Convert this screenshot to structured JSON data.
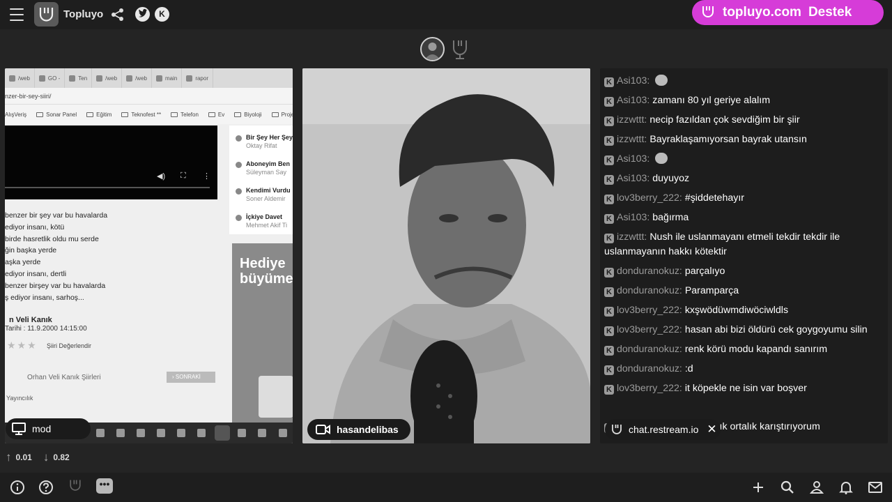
{
  "topbar": {
    "app_title": "Topluyo",
    "icons": [
      "menu-icon",
      "logo-icon",
      "share-icon",
      "twitter-icon",
      "kick-icon"
    ],
    "kick_glyph": "K"
  },
  "promo": {
    "text": "topluyo.com",
    "text2": "Destek"
  },
  "screen_share": {
    "tabs": [
      "/web",
      "GO -",
      "Ten",
      "/web",
      "/web",
      "main",
      "rapor"
    ],
    "url": "nzer-bir-sey-siiri/",
    "bookmarks": [
      "AlışVeriş",
      "Sonar Panel",
      "Eğitim",
      "Teknofest **",
      "Telefon",
      "Ev",
      "Biyoloji",
      "Proje"
    ],
    "video_controls": [
      "◀)",
      "⛶",
      "⋮"
    ],
    "poem_lines": [
      "benzer bir şey var bu havalarda",
      "ediyor insanı, kötü",
      "birde hasretlik oldu mu serde",
      "ğin başka yerde",
      "aşka yerde",
      "ediyor insanı, dertli",
      "benzer birşey var bu havalarda",
      "ş ediyor insanı, sarhoş..."
    ],
    "poet_name": "n Veli Kanık",
    "date": "Tarihi : 11.9.2000 14:15:00",
    "stars": "★★★",
    "rate_label": "Şiiri Değerlendir",
    "poet_poems": "Orhan Veli Kanık Şiirleri",
    "next_button": "› SONRAKİ",
    "publisher": "Yayıncılık",
    "side_items": [
      {
        "title": "Bir Şey Her Şey",
        "author": "Oktay Rifat"
      },
      {
        "title": "Aboneyim Ben",
        "author": "Süleyman Say"
      },
      {
        "title": "Kendimi Vurdu",
        "author": "Soner Aldemir"
      },
      {
        "title": "İçkiye Davet",
        "author": "Mehmet Akif Ti"
      }
    ],
    "ad_text": [
      "Hediye",
      "büyüme"
    ],
    "badge_label": "mod"
  },
  "webcam": {
    "badge_label": "hasandelibas"
  },
  "chat": {
    "messages": [
      {
        "user": "Asi103:",
        "text": "",
        "emoji": true
      },
      {
        "user": "Asi103:",
        "text": "zamanı 80 yıl geriye alalım",
        "emoji": false
      },
      {
        "user": "izzwttt:",
        "text": "necip fazıldan çok sevdiğim bir şiir",
        "emoji": false
      },
      {
        "user": "izzwttt:",
        "text": "Bayraklaşamıyorsan bayrak utansın",
        "emoji": false
      },
      {
        "user": "Asi103:",
        "text": "",
        "emoji": true
      },
      {
        "user": "Asi103:",
        "text": "duyuyoz",
        "emoji": false
      },
      {
        "user": "lov3berry_222:",
        "text": "#şiddetehayır",
        "emoji": false
      },
      {
        "user": "Asi103:",
        "text": "bağırma",
        "emoji": false
      },
      {
        "user": "izzwttt:",
        "text": "Nush ile uslanmayanı etmeli tekdir tekdir ile uslanmayanın hakkı kötektir",
        "emoji": false
      },
      {
        "user": "donduranokuz:",
        "text": "parçalıyo",
        "emoji": false
      },
      {
        "user": "donduranokuz:",
        "text": "Paramparça",
        "emoji": false
      },
      {
        "user": "lov3berry_222:",
        "text": "kxşwödüwmdiwöciwldls",
        "emoji": false
      },
      {
        "user": "lov3berry_222:",
        "text": "hasan abi bizi öldürü cek goygoyumu silin",
        "emoji": false
      },
      {
        "user": "donduranokuz:",
        "text": "renk körü modu kapandı sanırım",
        "emoji": false
      },
      {
        "user": "donduranokuz:",
        "text": ":d",
        "emoji": false
      },
      {
        "user": "lov3berry_222:",
        "text": "it köpekle ne isin var boşver",
        "emoji": false
      },
      {
        "user": "",
        "text": "",
        "emoji": false
      },
      {
        "user": "lov3berry_222:",
        "text": "ben azcık ortalık karıştırıyorum",
        "emoji": false
      }
    ],
    "badge_label": "chat.restream.io",
    "close_glyph": "✕"
  },
  "stats": {
    "up_arrow": "↑",
    "upload": "0.01",
    "down_arrow": "↓",
    "download": "0.82"
  },
  "bottombar": {
    "chat_glyph": "•••",
    "icons": [
      "info-icon",
      "help-icon",
      "logo-icon",
      "chat-icon",
      "plus-icon",
      "search-icon",
      "user-icon",
      "bell-icon",
      "mail-icon"
    ]
  },
  "colors": {
    "promo": "#d63cd8",
    "background": "#242424",
    "bar": "#1e1e1e",
    "chat_username": "#9a9a9a"
  }
}
